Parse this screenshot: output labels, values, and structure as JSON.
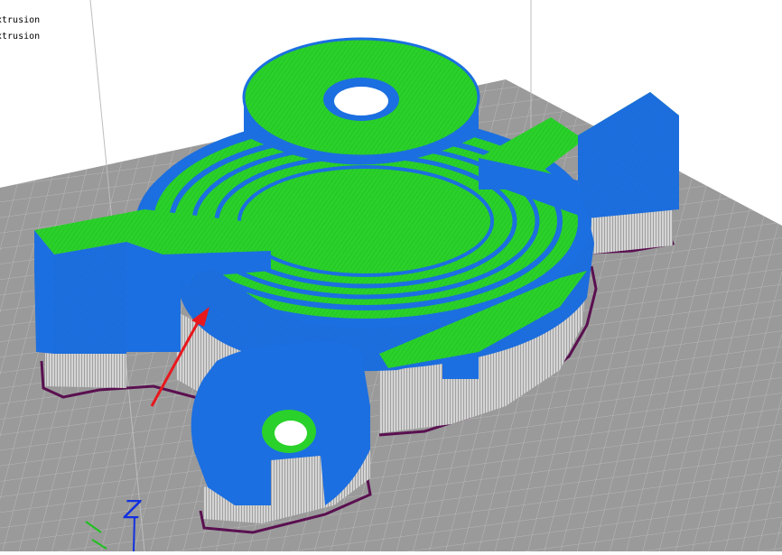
{
  "legend": {
    "line1": "xtrusion",
    "line2": "xtrusion"
  },
  "axes": {
    "z_label": "Z"
  },
  "colors": {
    "background": "#ffffff",
    "build_plate": "#9a9a9a",
    "grid_line": "#c2c2c2",
    "perimeter_blue": "#1c6fe0",
    "infill_green": "#2ad12a",
    "support_gray": "#d9d9d9",
    "skirt_purple": "#5a1050",
    "arrow_red": "#e8181d",
    "z_axis_blue": "#1030e0",
    "y_axis_green": "#20c020"
  },
  "scene": {
    "view": "3d-perspective",
    "objects": [
      "build-plate",
      "sliced-part",
      "support-material",
      "skirt-outline",
      "selection-arrow"
    ]
  }
}
